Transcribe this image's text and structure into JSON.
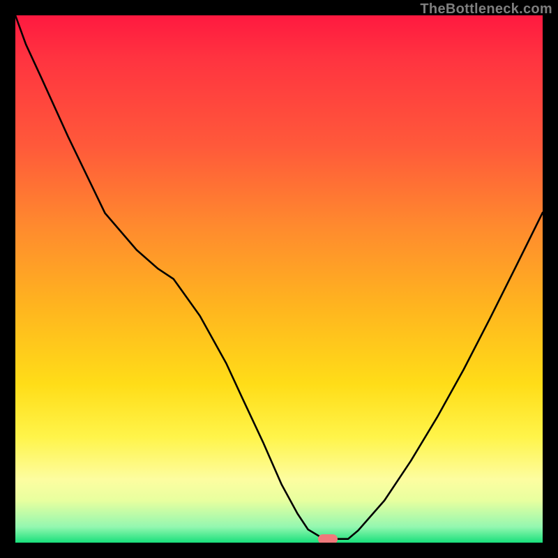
{
  "watermark": "TheBottleneck.com",
  "marker": {
    "color": "#f0797b",
    "x_frac": 0.593,
    "y_frac": 0.994
  },
  "chart_data": {
    "type": "line",
    "title": "",
    "xlabel": "",
    "ylabel": "",
    "xlim": [
      0,
      1
    ],
    "ylim": [
      0,
      1
    ],
    "x": [
      0.0,
      0.02,
      0.05,
      0.1,
      0.17,
      0.23,
      0.27,
      0.3,
      0.35,
      0.4,
      0.43,
      0.47,
      0.505,
      0.535,
      0.555,
      0.585,
      0.631,
      0.65,
      0.7,
      0.75,
      0.8,
      0.85,
      0.9,
      0.95,
      1.0
    ],
    "y": [
      0.0,
      0.055,
      0.12,
      0.23,
      0.375,
      0.445,
      0.48,
      0.5,
      0.57,
      0.66,
      0.725,
      0.81,
      0.89,
      0.945,
      0.975,
      0.993,
      0.993,
      0.977,
      0.92,
      0.845,
      0.762,
      0.672,
      0.575,
      0.475,
      0.374
    ],
    "note": "x,y are normalized (0..1) with y=0 at top, y=1 at bottom; curve is a V-shaped bottleneck profile with minimum near x≈0.60 touching the bottom green band.",
    "background_gradient_stops": [
      {
        "pos": 0.0,
        "color": "#ff1940"
      },
      {
        "pos": 0.25,
        "color": "#ff5a3a"
      },
      {
        "pos": 0.55,
        "color": "#ffb41f"
      },
      {
        "pos": 0.8,
        "color": "#fff44a"
      },
      {
        "pos": 0.97,
        "color": "#94f7b0"
      },
      {
        "pos": 1.0,
        "color": "#19e07b"
      }
    ]
  }
}
